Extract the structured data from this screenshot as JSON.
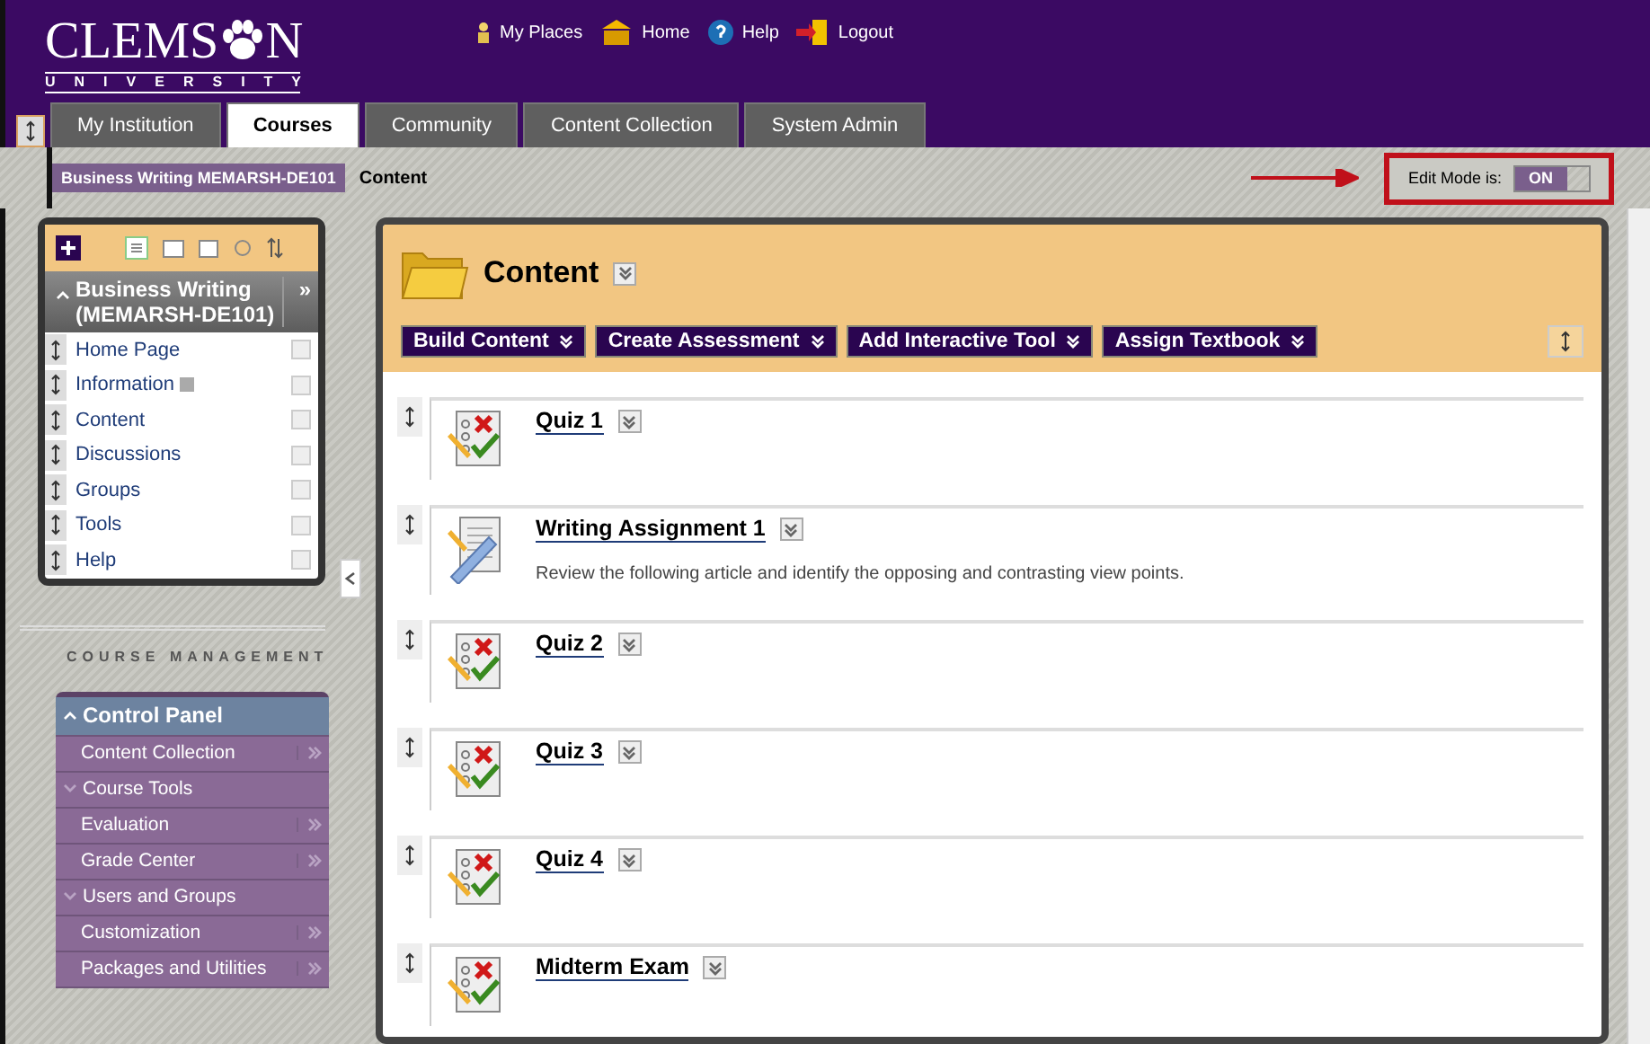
{
  "logo": {
    "left": "CLEMS",
    "right": "N",
    "subtitle": "UNIVERSITY"
  },
  "top_links": [
    {
      "kind": "places",
      "label": "My Places"
    },
    {
      "kind": "home",
      "label": "Home"
    },
    {
      "kind": "help",
      "label": "Help"
    },
    {
      "kind": "logout",
      "label": "Logout"
    }
  ],
  "tabs": [
    {
      "label": "My Institution",
      "selected": false
    },
    {
      "label": "Courses",
      "selected": true
    },
    {
      "label": "Community",
      "selected": false
    },
    {
      "label": "Content Collection",
      "selected": false
    },
    {
      "label": "System Admin",
      "selected": false
    }
  ],
  "breadcrumb": {
    "course": "Business Writing MEMARSH-DE101",
    "page": "Content"
  },
  "edit_mode": {
    "label": "Edit Mode is:",
    "state": "ON",
    "on": true
  },
  "course_menu": {
    "title": "Business Writing (MEMARSH-DE101)",
    "expand": "»",
    "items": [
      {
        "label": "Home Page",
        "info": false
      },
      {
        "label": "Information",
        "info": true
      },
      {
        "label": "Content",
        "info": false
      },
      {
        "label": "Discussions",
        "info": false
      },
      {
        "label": "Groups",
        "info": false
      },
      {
        "label": "Tools",
        "info": false
      },
      {
        "label": "Help",
        "info": false
      }
    ]
  },
  "course_management": {
    "heading": "COURSE MANAGEMENT",
    "items": [
      {
        "kind": "header",
        "label": "Control Panel"
      },
      {
        "kind": "link",
        "label": "Content Collection"
      },
      {
        "kind": "section",
        "label": "Course Tools"
      },
      {
        "kind": "link",
        "label": "Evaluation"
      },
      {
        "kind": "link",
        "label": "Grade Center"
      },
      {
        "kind": "section",
        "label": "Users and Groups"
      },
      {
        "kind": "link",
        "label": "Customization"
      },
      {
        "kind": "link",
        "label": "Packages and Utilities"
      }
    ]
  },
  "content": {
    "title": "Content",
    "actions": [
      "Build Content",
      "Create Assessment",
      "Add Interactive Tool",
      "Assign Textbook"
    ],
    "items": [
      {
        "kind": "quiz",
        "title": "Quiz 1"
      },
      {
        "kind": "assignment",
        "title": "Writing Assignment 1",
        "description": "Review the following article and identify the opposing and contrasting view points."
      },
      {
        "kind": "quiz",
        "title": "Quiz 2"
      },
      {
        "kind": "quiz",
        "title": "Quiz 3"
      },
      {
        "kind": "quiz",
        "title": "Quiz 4"
      },
      {
        "kind": "quiz",
        "title": "Midterm Exam"
      }
    ]
  }
}
